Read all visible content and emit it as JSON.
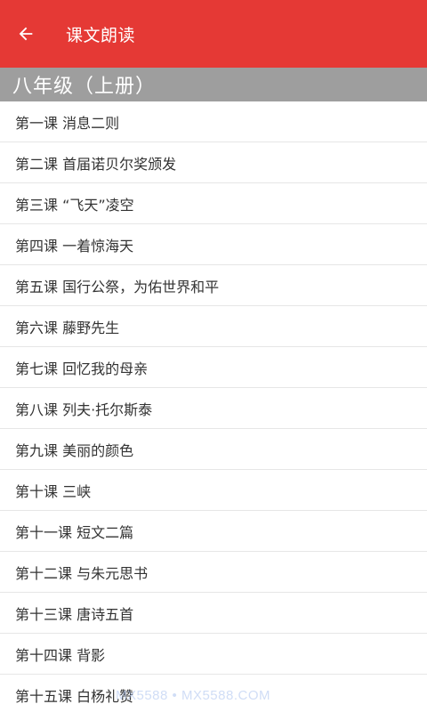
{
  "colors": {
    "toolbar": "#e53935",
    "section_header": "#9e9e9e",
    "list_text": "#333333",
    "divider": "#e6e6e6"
  },
  "toolbar": {
    "back_icon": "arrow-left-icon",
    "title": "课文朗读"
  },
  "section": {
    "title": "八年级（上册）"
  },
  "lessons": [
    "第一课 消息二则",
    "第二课 首届诺贝尔奖颁发",
    "第三课 “飞天”凌空",
    "第四课 一着惊海天",
    "第五课 国行公祭，为佑世界和平",
    "第六课 藤野先生",
    "第七课 回忆我的母亲",
    "第八课 列夫·托尔斯泰",
    "第九课 美丽的颜色",
    "第十课 三峡",
    "第十一课 短文二篇",
    "第十二课 与朱元思书",
    "第十三课 唐诗五首",
    "第十四课 背影",
    "第十五课 白杨礼赞"
  ],
  "watermark": "MX5588 • MX5588.COM"
}
